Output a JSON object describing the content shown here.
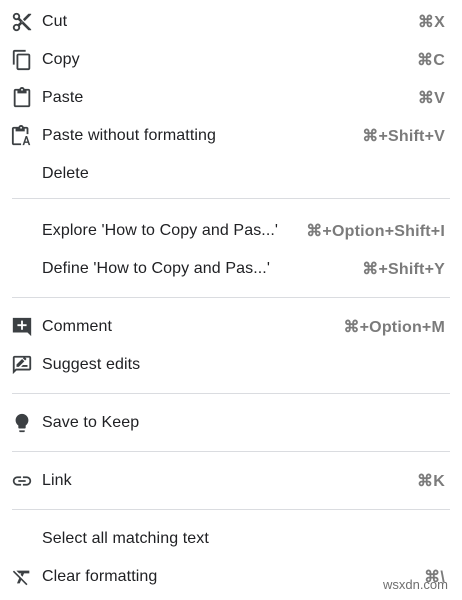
{
  "menu": {
    "cut": {
      "label": "Cut",
      "shortcut": "⌘X",
      "icon": "scissors-icon"
    },
    "copy": {
      "label": "Copy",
      "shortcut": "⌘C",
      "icon": "copy-icon"
    },
    "paste": {
      "label": "Paste",
      "shortcut": "⌘V",
      "icon": "clipboard-icon"
    },
    "paste_plain": {
      "label": "Paste without formatting",
      "shortcut": "⌘+Shift+V",
      "icon": "clipboard-plain-icon"
    },
    "delete": {
      "label": "Delete"
    },
    "explore": {
      "label": "Explore 'How to Copy and Pas...'",
      "shortcut": "⌘+Option+Shift+I"
    },
    "define": {
      "label": "Define 'How to Copy and Pas...'",
      "shortcut": "⌘+Shift+Y"
    },
    "comment": {
      "label": "Comment",
      "shortcut": "⌘+Option+M",
      "icon": "add-comment-icon"
    },
    "suggest": {
      "label": "Suggest edits",
      "icon": "suggest-edits-icon"
    },
    "keep": {
      "label": "Save to Keep",
      "icon": "lightbulb-icon"
    },
    "link": {
      "label": "Link",
      "shortcut": "⌘K",
      "icon": "link-icon"
    },
    "select_matching": {
      "label": "Select all matching text"
    },
    "clear_format": {
      "label": "Clear formatting",
      "shortcut": "⌘\\",
      "icon": "clear-format-icon"
    }
  },
  "watermark": "wsxdn.com",
  "colors": {
    "text": "#202124",
    "shortcut": "#7b7b7b",
    "icon": "#3c4043",
    "divider": "#dadce0"
  }
}
